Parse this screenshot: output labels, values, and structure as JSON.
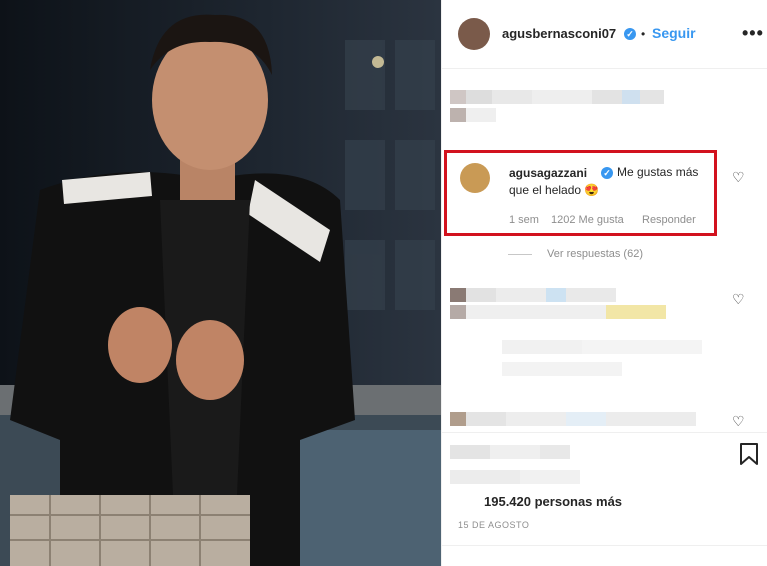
{
  "post": {
    "username": "agusbernasconi07",
    "follow_label": "Seguir",
    "more_label": "•••",
    "likes_text": "195.420 personas más",
    "date": "15 DE AGOSTO"
  },
  "highlighted_comment": {
    "username": "agusagazzani",
    "text_line1": "Me gustas más",
    "text_line2": "que el helado 😍",
    "time": "1 sem",
    "likes": "1202 Me gusta",
    "reply_label": "Responder",
    "view_replies": "Ver respuestas (62)"
  },
  "icons": {
    "verified": "verified-badge-icon",
    "heart": "heart-icon",
    "bookmark": "bookmark-icon"
  },
  "colors": {
    "accent": "#3897f0",
    "highlight_border": "#d2121e"
  }
}
